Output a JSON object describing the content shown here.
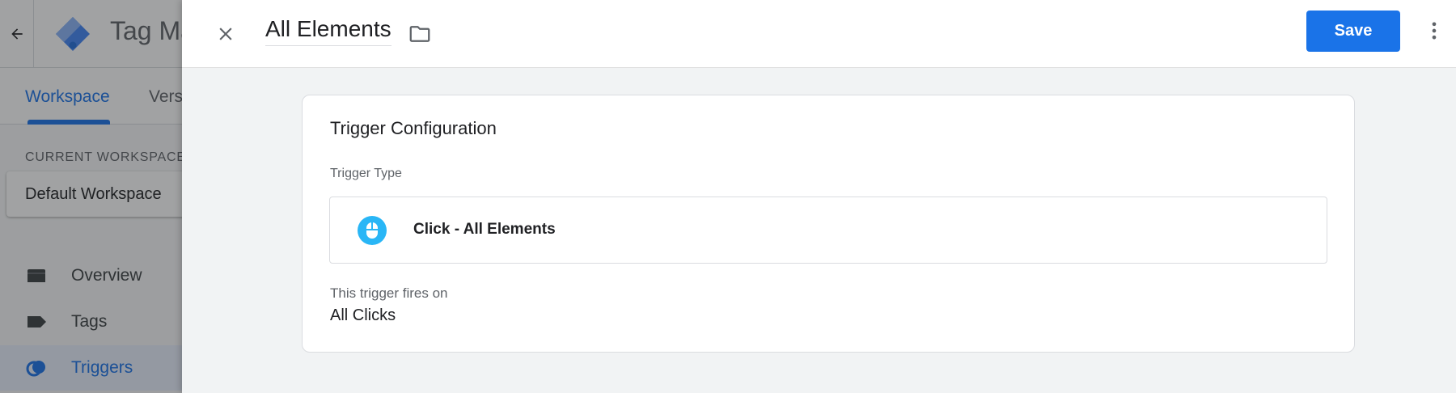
{
  "background_app": {
    "app_title": "Tag Ma",
    "tabs": [
      {
        "label": "Workspace",
        "active": true
      },
      {
        "label": "Vers",
        "active": false
      }
    ],
    "current_workspace_label": "CURRENT WORKSPACE",
    "current_workspace_name": "Default Workspace",
    "nav_items": [
      {
        "label": "Overview",
        "icon": "folder-icon",
        "active": false
      },
      {
        "label": "Tags",
        "icon": "tag-icon",
        "active": false
      },
      {
        "label": "Triggers",
        "icon": "triggers-icon",
        "active": true
      }
    ]
  },
  "panel": {
    "title": "All Elements",
    "save_label": "Save"
  },
  "card": {
    "title": "Trigger Configuration",
    "trigger_type_label": "Trigger Type",
    "trigger_type_name": "Click - All Elements",
    "trigger_type_icon": "mouse-click-icon",
    "fires_on_label": "This trigger fires on",
    "fires_on_value": "All Clicks"
  },
  "colors": {
    "accent": "#1a73e8",
    "icon_blue": "#29b6f6",
    "scrim": "rgba(32,33,36,0.42)"
  }
}
